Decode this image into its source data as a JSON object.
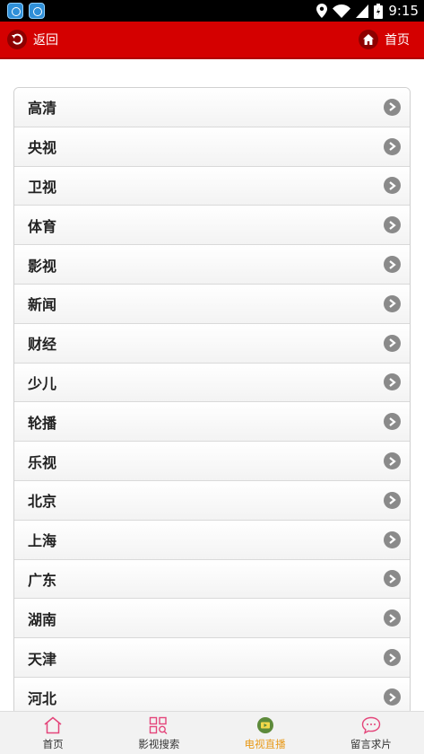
{
  "status_bar": {
    "time": "9:15",
    "icons": [
      "app-icon",
      "app-icon",
      "location-icon",
      "wifi-icon",
      "signal-icon",
      "battery-icon"
    ]
  },
  "header": {
    "back_label": "返回",
    "home_label": "首页",
    "background": "#d40000"
  },
  "channels": [
    "高清",
    "央视",
    "卫视",
    "体育",
    "影视",
    "新闻",
    "财经",
    "少儿",
    "轮播",
    "乐视",
    "北京",
    "上海",
    "广东",
    "湖南",
    "天津",
    "河北"
  ],
  "bottom_nav": {
    "items": [
      {
        "label": "首页",
        "icon": "home-icon"
      },
      {
        "label": "影视搜索",
        "icon": "grid-search-icon"
      },
      {
        "label": "电视直播",
        "icon": "tv-play-icon",
        "active": true
      },
      {
        "label": "留言求片",
        "icon": "chat-bubble-icon"
      }
    ],
    "active_color": "#e89a1a",
    "icon_color": "#e4457a"
  }
}
